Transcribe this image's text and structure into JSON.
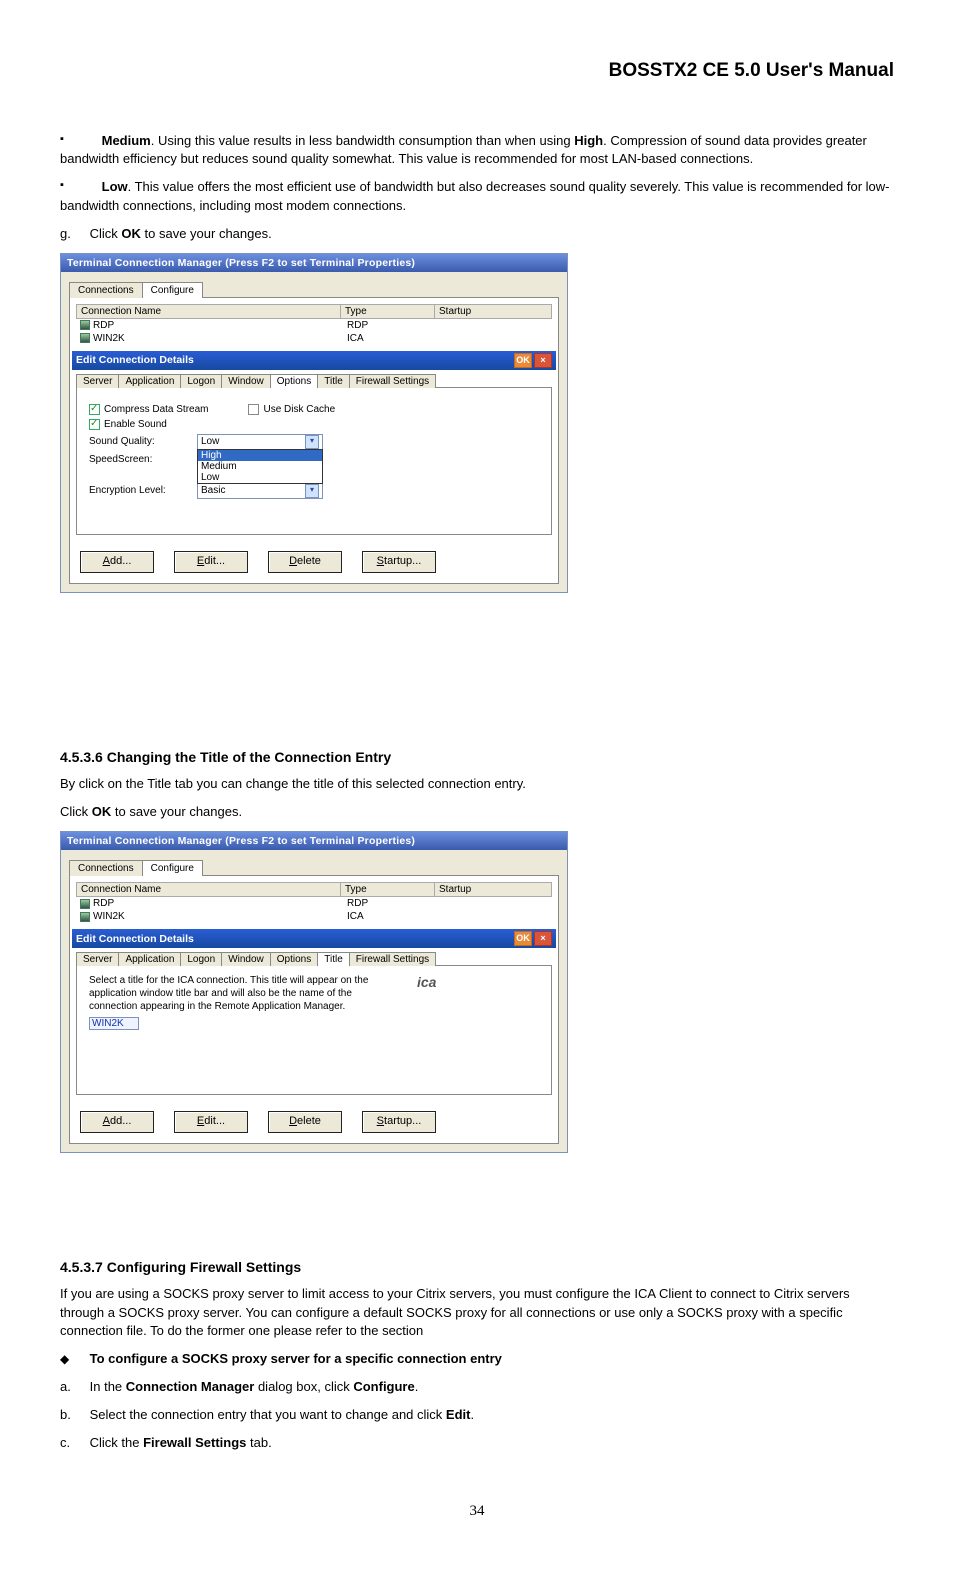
{
  "header": {
    "title": "BOSSTX2 CE 5.0 User's Manual"
  },
  "body": {
    "para_medium_pre": "Medium",
    "para_medium_txt": ". Using this value results in less bandwidth consumption than when using ",
    "para_medium_high": "High",
    "para_medium_end": ". Compression of sound data provides greater bandwidth efficiency but reduces sound quality somewhat. This value is recommended for most LAN-based connections.",
    "para_low_pre": "Low",
    "para_low_txt": ". This value offers the most efficient use of bandwidth but also decreases sound quality severely. This value is recommended for low-bandwidth connections, including most modem connections.",
    "step_g_letter": "g.",
    "step_g_txt1": "Click ",
    "step_g_ok": "OK",
    "step_g_txt2": " to save your changes."
  },
  "fig1": {
    "window_title": "Terminal Connection Manager (Press F2 to set Terminal Properties)",
    "outer_tabs": [
      "Connections",
      "Configure"
    ],
    "outer_active": 1,
    "cols": [
      "Connection Name",
      "Type",
      "Startup"
    ],
    "rows": [
      {
        "name": "RDP",
        "type": "RDP"
      },
      {
        "name": "WIN2K",
        "type": "ICA"
      }
    ],
    "dlg_title": "Edit Connection Details",
    "dlg_ok": "OK",
    "dlg_close": "×",
    "inner_tabs": [
      "Server",
      "Application",
      "Logon",
      "Window",
      "Options",
      "Title",
      "Firewall Settings"
    ],
    "inner_active": 4,
    "chk_compress": "Compress Data Stream",
    "chk_cache": "Use Disk Cache",
    "chk_sound": "Enable Sound",
    "lbl_sound_q": "Sound Quality:",
    "lbl_speed": "SpeedScreen:",
    "lbl_enc": "Encryption Level:",
    "dd_sound_val": "Low",
    "dd_list": [
      "High",
      "Medium",
      "Low"
    ],
    "dd_enc_val": "Basic",
    "btns": {
      "add": "Add...",
      "edit": "Edit...",
      "delete": "Delete",
      "startup": "Startup..."
    }
  },
  "sec_title": {
    "heading": "4.5.3.6  Changing the Title of the Connection Entry",
    "p1": "By click on the Title tab you can change the title of this selected connection entry.",
    "p2a": "Click ",
    "p2ok": "OK",
    "p2b": " to save your changes."
  },
  "fig2": {
    "window_title": "Terminal Connection Manager (Press F2 to set Terminal Properties)",
    "inner_active": 5,
    "desc": "Select a title for the ICA connection. This title will appear on the application window title bar and will also be the name of the connection appearing in the Remote Application Manager.",
    "ica_label": "ica",
    "input_val": "WIN2K"
  },
  "sec_fw": {
    "heading": "4.5.3.7  Configuring Firewall Settings",
    "p1": "If you are using a SOCKS proxy server to limit access to your Citrix servers, you must configure the ICA Client to connect to Citrix servers through a SOCKS proxy server. You can configure a default SOCKS proxy for all connections or use only a SOCKS proxy with a specific connection file. To do the former one please refer to the section",
    "sub_bold": "To configure a SOCKS proxy server for a specific connection entry",
    "a_letter": "a.",
    "a_txt1": "In the ",
    "a_cm": "Connection Manager",
    "a_txt2": " dialog box, click ",
    "a_conf": "Configure",
    "a_dot": ".",
    "b_letter": "b.",
    "b_txt1": "Select the connection entry that you want to change and click ",
    "b_edit": "Edit",
    "b_dot": ".",
    "c_letter": "c.",
    "c_txt1": "Click the ",
    "c_fw": "Firewall Settings",
    "c_txt2": " tab."
  },
  "page_number": "34"
}
